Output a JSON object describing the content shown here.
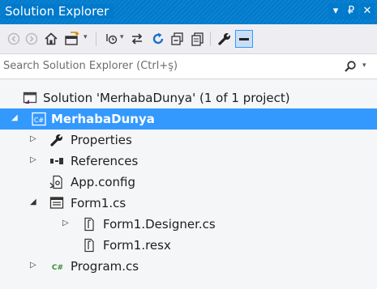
{
  "window": {
    "title": "Solution Explorer",
    "controls": [
      "▾",
      "₽",
      "✕"
    ]
  },
  "toolbar": {
    "buttons": [
      "back-arrow",
      "forward-arrow",
      "home",
      "switch-views",
      "pending-changes",
      "sync",
      "refresh",
      "collapse-all",
      "show-all-files",
      "properties",
      "preview"
    ]
  },
  "search": {
    "placeholder": "Search Solution Explorer (Ctrl+ş)",
    "icon": "search-icon"
  },
  "tree": {
    "items": [
      {
        "label": "Solution 'MerhabaDunya' (1 of 1 project)",
        "icon": "solution-icon",
        "expander": ""
      },
      {
        "label": "MerhabaDunya",
        "icon": "csharp-project-icon",
        "expander": "◢",
        "selected": true
      },
      {
        "label": "Properties",
        "icon": "wrench-icon",
        "expander": "▷"
      },
      {
        "label": "References",
        "icon": "references-icon",
        "expander": "▷"
      },
      {
        "label": "App.config",
        "icon": "config-file-icon",
        "expander": ""
      },
      {
        "label": "Form1.cs",
        "icon": "form-icon",
        "expander": "◢"
      },
      {
        "label": "Form1.Designer.cs",
        "icon": "cs-file-icon",
        "expander": "▷"
      },
      {
        "label": "Form1.resx",
        "icon": "resx-file-icon",
        "expander": ""
      },
      {
        "label": "Program.cs",
        "icon": "csharp-file-icon",
        "expander": "▷"
      }
    ]
  },
  "colors": {
    "accent": "#007acc",
    "selection": "#3399ff",
    "background": "#f5f6f7",
    "toolbar": "#eeeef2"
  }
}
